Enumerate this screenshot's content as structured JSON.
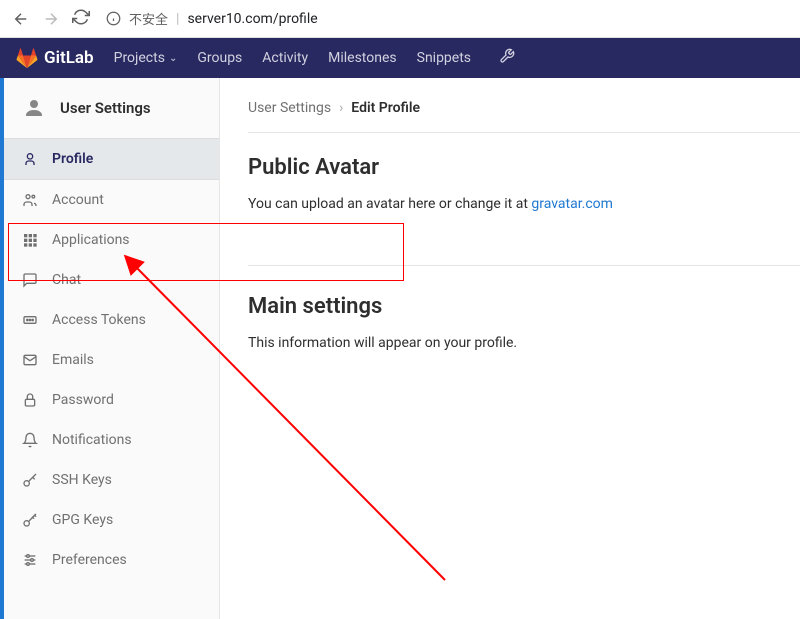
{
  "browser": {
    "insecure_label": "不安全",
    "url": "server10.com/profile"
  },
  "header": {
    "brand": "GitLab",
    "nav": {
      "projects": "Projects",
      "groups": "Groups",
      "activity": "Activity",
      "milestones": "Milestones",
      "snippets": "Snippets"
    }
  },
  "sidebar": {
    "title": "User Settings",
    "items": {
      "profile": "Profile",
      "account": "Account",
      "applications": "Applications",
      "chat": "Chat",
      "access_tokens": "Access Tokens",
      "emails": "Emails",
      "password": "Password",
      "notifications": "Notifications",
      "ssh_keys": "SSH Keys",
      "gpg_keys": "GPG Keys",
      "preferences": "Preferences"
    }
  },
  "content": {
    "breadcrumb_root": "User Settings",
    "breadcrumb_current": "Edit Profile",
    "avatar_title": "Public Avatar",
    "avatar_desc_prefix": "You can upload an avatar here or change it at ",
    "avatar_link": "gravatar.com",
    "main_title": "Main settings",
    "main_desc": "This information will appear on your profile."
  }
}
